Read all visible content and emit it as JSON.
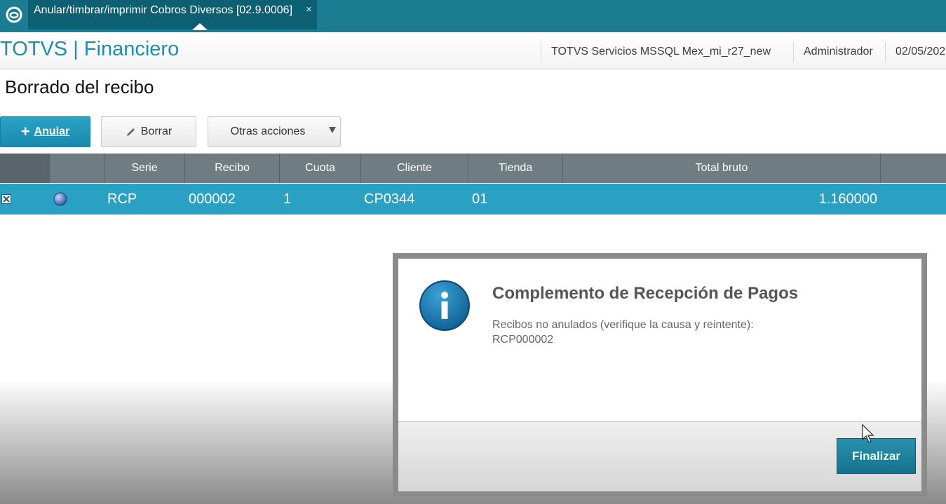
{
  "tab": {
    "label": "Anular/timbrar/imprimir Cobros Diversos [02.9.0006]",
    "close": "×"
  },
  "header": {
    "app_title": "TOTVS | Financiero",
    "environment": "TOTVS Servicios MSSQL Mex_mi_r27_new",
    "user": "Administrador",
    "date": "02/05/202"
  },
  "page": {
    "title": "Borrado del recibo"
  },
  "toolbar": {
    "anular_label": "Anular",
    "borrar_label": "Borrar",
    "otras_label": "Otras acciones"
  },
  "grid": {
    "columns": [
      "Serie",
      "Recibo",
      "Cuota",
      "Cliente",
      "Tienda",
      "Total bruto"
    ],
    "rows": [
      {
        "serie": "RCP",
        "recibo": "000002",
        "cuota": "1",
        "cliente": "CP0344",
        "tienda": "01",
        "total_bruto": "1.160000"
      }
    ]
  },
  "dialog": {
    "title": "Complemento de Recepción de Pagos",
    "message_line1": "Recibos no anulados (verifique la causa y reintente):",
    "message_line2": "RCP000002",
    "button_label": "Finalizar"
  },
  "colors": {
    "accent": "#1f8db0",
    "topbar": "#1c7c92",
    "selected_row": "#2aa0c2",
    "grid_header": "#6f7c81"
  }
}
